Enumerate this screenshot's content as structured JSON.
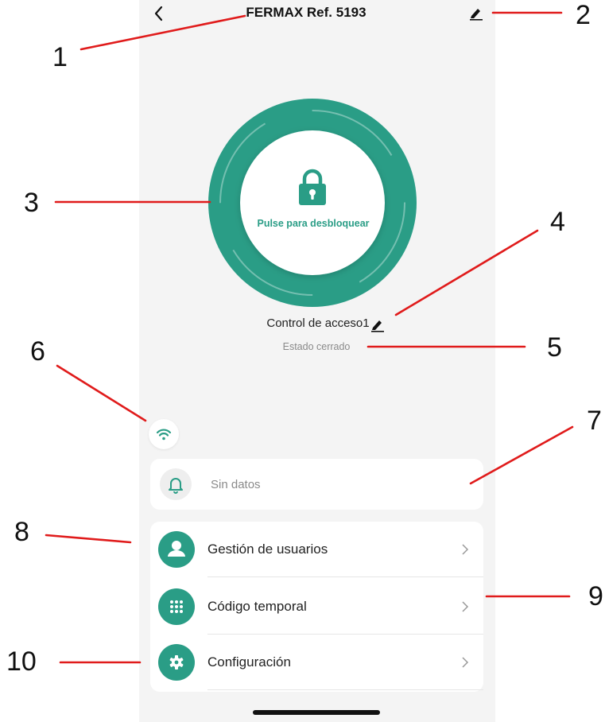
{
  "header": {
    "title": "FERMAX Ref. 5193"
  },
  "lock": {
    "label": "Pulse para desbloquear"
  },
  "access": {
    "name": "Control de acceso1",
    "status": "Estado cerrado"
  },
  "notifications": {
    "text": "Sin datos"
  },
  "menu": {
    "items": [
      {
        "label": "Gestión de usuarios",
        "icon": "user-icon"
      },
      {
        "label": "Código temporal",
        "icon": "keypad-icon"
      },
      {
        "label": "Configuración",
        "icon": "gear-icon"
      }
    ]
  },
  "callouts": [
    "1",
    "2",
    "3",
    "4",
    "5",
    "6",
    "7",
    "8",
    "9",
    "10"
  ],
  "colors": {
    "accent": "#2a9d86",
    "ring": "#2a9d86",
    "callout_line": "#e01b1b",
    "background": "#f4f4f4"
  }
}
